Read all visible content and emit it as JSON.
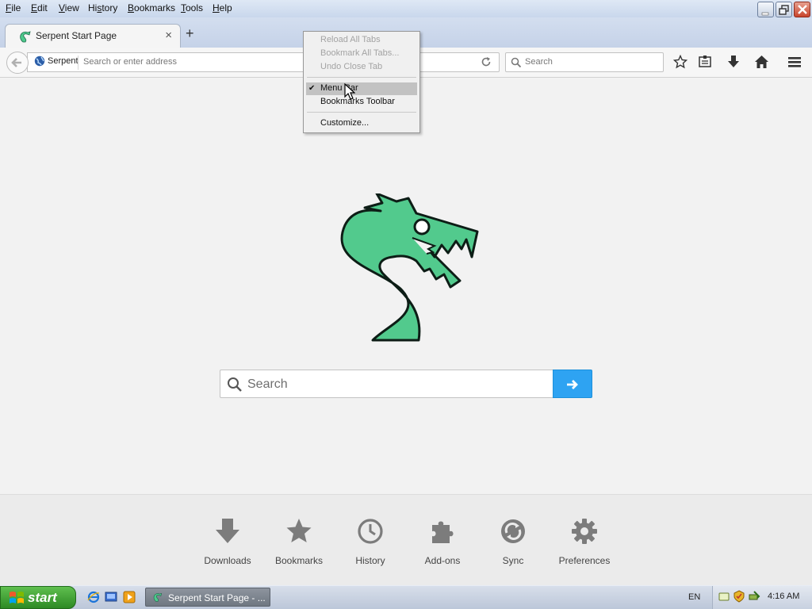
{
  "menubar": {
    "items": [
      {
        "pre": "",
        "key": "F",
        "post": "ile"
      },
      {
        "pre": "",
        "key": "E",
        "post": "dit"
      },
      {
        "pre": "",
        "key": "V",
        "post": "iew"
      },
      {
        "pre": "Hi",
        "key": "s",
        "post": "tory"
      },
      {
        "pre": "",
        "key": "B",
        "post": "ookmarks"
      },
      {
        "pre": "",
        "key": "T",
        "post": "ools"
      },
      {
        "pre": "",
        "key": "H",
        "post": "elp"
      }
    ]
  },
  "tab": {
    "title": "Serpent Start Page",
    "close": "×"
  },
  "newtab": {
    "label": "+"
  },
  "urlbar": {
    "identity": "Serpent",
    "placeholder": "Search or enter address"
  },
  "searchbar": {
    "placeholder": "Search"
  },
  "context_menu": {
    "items": [
      {
        "label": "Reload All Tabs",
        "enabled": false
      },
      {
        "label": "Bookmark All Tabs...",
        "enabled": false
      },
      {
        "label": "Undo Close Tab",
        "enabled": false
      },
      {
        "label": "Menu Bar",
        "enabled": true,
        "checked": true,
        "highlighted": true
      },
      {
        "label": "Bookmarks Toolbar",
        "enabled": true,
        "checked": false
      },
      {
        "label": "Customize...",
        "enabled": true
      }
    ],
    "checkmark": "✔"
  },
  "main": {
    "search_placeholder": "Search"
  },
  "launcher": {
    "items": [
      {
        "label": "Downloads",
        "icon": "download-icon"
      },
      {
        "label": "Bookmarks",
        "icon": "star-icon"
      },
      {
        "label": "History",
        "icon": "clock-icon"
      },
      {
        "label": "Add-ons",
        "icon": "puzzle-icon"
      },
      {
        "label": "Sync",
        "icon": "sync-icon"
      },
      {
        "label": "Preferences",
        "icon": "gear-icon"
      }
    ]
  },
  "taskbar": {
    "start_label": "start",
    "task_label": "Serpent Start Page - ...",
    "language": "EN",
    "clock": "4:16 AM"
  },
  "colors": {
    "brand_green": "#4ec98c",
    "search_blue": "#2ea3f2"
  }
}
